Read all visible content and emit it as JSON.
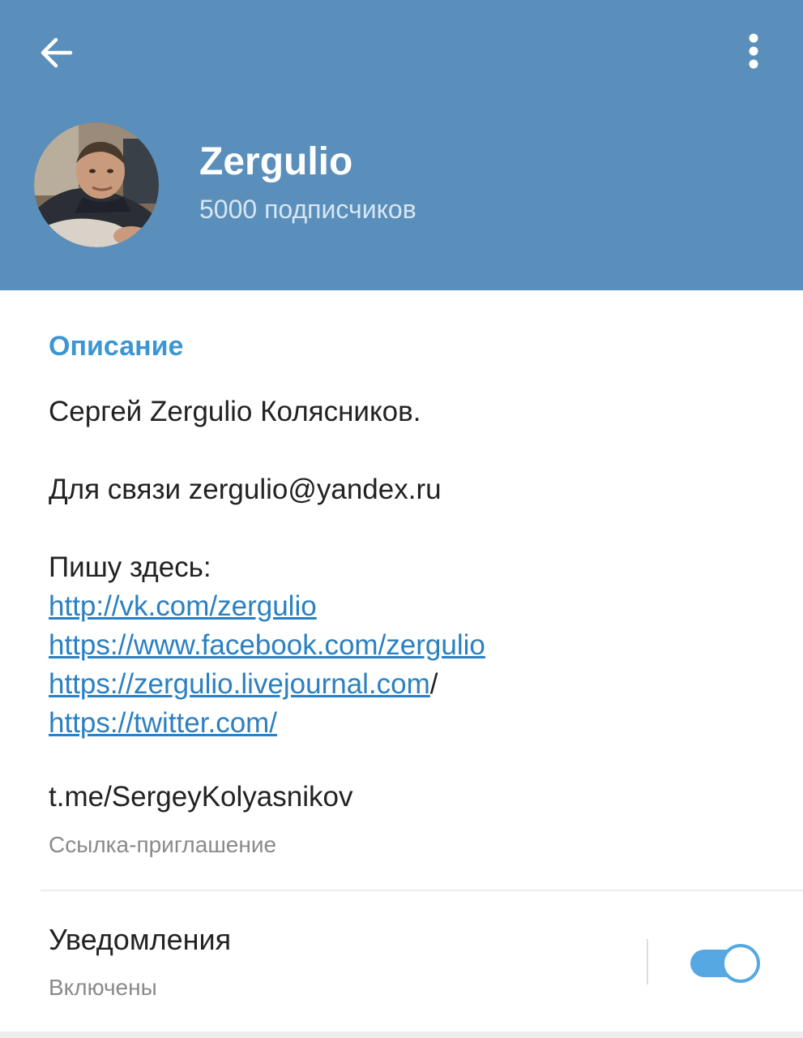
{
  "header": {
    "channel_name": "Zergulio",
    "subscribers": "5000 подписчиков",
    "back_icon": "arrow-left-icon",
    "menu_icon": "more-vertical-icon",
    "color": "#5a8fbb"
  },
  "about": {
    "section_title": "Описание",
    "line_name": "Сергей Zergulio Колясников.",
    "line_contact": "Для связи zergulio@yandex.ru",
    "line_write_here": "Пишу здесь:",
    "links": [
      "http://vk.com/zergulio",
      "https://www.facebook.com/zergulio",
      "https://zergulio.livejournal.com",
      "https://twitter.com/"
    ],
    "trailing_slash": "/"
  },
  "invite": {
    "link": "t.me/SergeyKolyasnikov",
    "label": "Ссылка-приглашение"
  },
  "notifications": {
    "label": "Уведомления",
    "status": "Включены",
    "enabled": true,
    "accent_color": "#56a8e2"
  }
}
